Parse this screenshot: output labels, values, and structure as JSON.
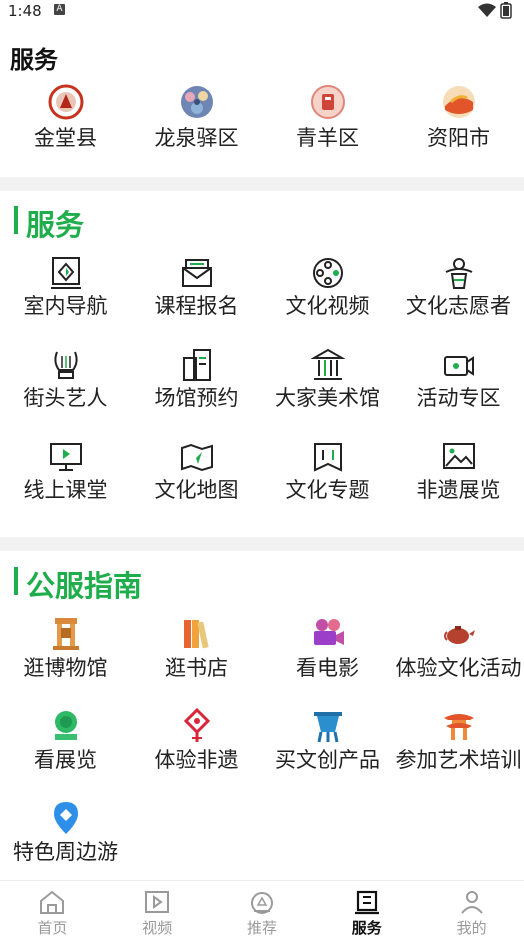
{
  "status_bar": {
    "time": "1:48"
  },
  "section1": {
    "title": "服务",
    "items": [
      {
        "label": "金堂县",
        "icon": "jintang-logo-icon"
      },
      {
        "label": "龙泉驿区",
        "icon": "longquanyi-logo-icon"
      },
      {
        "label": "青羊区",
        "icon": "qingyang-logo-icon"
      },
      {
        "label": "资阳市",
        "icon": "ziyang-logo-icon"
      }
    ]
  },
  "section2": {
    "title": "服务",
    "items": [
      {
        "label": "室内导航",
        "icon": "indoor-navigation-icon"
      },
      {
        "label": "课程报名",
        "icon": "course-signup-icon"
      },
      {
        "label": "文化视频",
        "icon": "film-reel-icon"
      },
      {
        "label": "文化志愿者",
        "icon": "volunteer-icon"
      },
      {
        "label": "街头艺人",
        "icon": "lyre-icon"
      },
      {
        "label": "场馆预约",
        "icon": "venue-booking-icon"
      },
      {
        "label": "大家美术馆",
        "icon": "museum-icon"
      },
      {
        "label": "活动专区",
        "icon": "video-camera-icon"
      },
      {
        "label": "线上课堂",
        "icon": "online-class-icon"
      },
      {
        "label": "文化地图",
        "icon": "map-icon"
      },
      {
        "label": "文化专题",
        "icon": "topic-icon"
      },
      {
        "label": "非遗展览",
        "icon": "gallery-image-icon"
      }
    ]
  },
  "section3": {
    "title": "公服指南",
    "items": [
      {
        "label": "逛博物馆",
        "icon": "museum-gate-icon"
      },
      {
        "label": "逛书店",
        "icon": "books-icon"
      },
      {
        "label": "看电影",
        "icon": "movie-camera-icon"
      },
      {
        "label": "体验文化活动",
        "icon": "teapot-icon"
      },
      {
        "label": "看展览",
        "icon": "exhibition-icon"
      },
      {
        "label": "体验非遗",
        "icon": "chinese-knot-icon"
      },
      {
        "label": "买文创产品",
        "icon": "bronze-vessel-icon"
      },
      {
        "label": "参加艺术培训",
        "icon": "pavilion-icon"
      },
      {
        "label": "特色周边游",
        "icon": "location-pin-icon"
      }
    ]
  },
  "tabbar": {
    "items": [
      {
        "label": "首页",
        "icon": "home-icon",
        "active": false
      },
      {
        "label": "视频",
        "icon": "video-icon",
        "active": false
      },
      {
        "label": "推荐",
        "icon": "recommend-icon",
        "active": false
      },
      {
        "label": "服务",
        "icon": "service-icon",
        "active": true
      },
      {
        "label": "我的",
        "icon": "profile-icon",
        "active": false
      }
    ]
  },
  "colors": {
    "accent_green": "#1fae4b",
    "section_bg": "#f1f1f1",
    "tab_inactive": "#9a9a9a"
  }
}
